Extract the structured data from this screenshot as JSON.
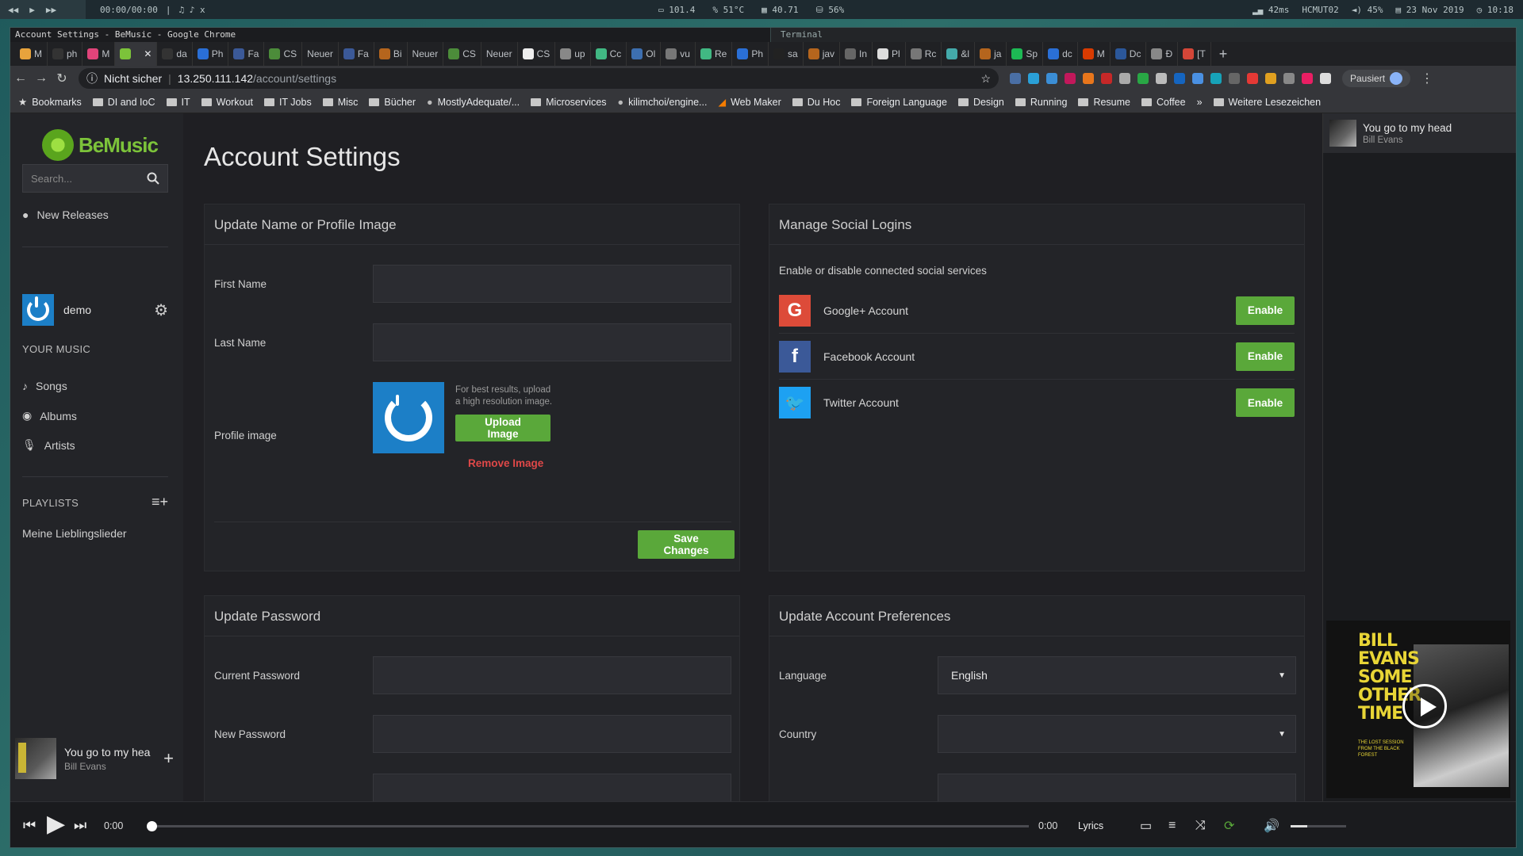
{
  "system_bar": {
    "media_time": "00:00/00:00",
    "sep": "|",
    "notes": "♫ ♪ x",
    "cpu": "101.4",
    "temp": "51°C",
    "mem": "40.71",
    "disk": "56%",
    "latency": "42ms",
    "network": "HCMUT02",
    "volume": "45%",
    "date": "23 Nov 2019",
    "time": "10:18"
  },
  "window": {
    "title": "Account Settings - BeMusic - Google Chrome",
    "terminal_title": "Terminal"
  },
  "tabs": [
    {
      "label": "M",
      "color": "#e8a33c"
    },
    {
      "label": "ph",
      "color": "#333"
    },
    {
      "label": "M",
      "color": "#e0447a"
    },
    {
      "label": "",
      "color": "#7cc33a",
      "active": true
    },
    {
      "label": "da",
      "color": "#333"
    },
    {
      "label": "Ph",
      "color": "#2a6fd6"
    },
    {
      "label": "Fa",
      "color": "#3b5998"
    },
    {
      "label": "CS",
      "color": "#4c8c3a"
    },
    {
      "label": "Neuer",
      "color": ""
    },
    {
      "label": "Fa",
      "color": "#3b5998"
    },
    {
      "label": "Bi",
      "color": "#b5651d"
    },
    {
      "label": "Neuer",
      "color": ""
    },
    {
      "label": "CS",
      "color": "#4c8c3a"
    },
    {
      "label": "Neuer",
      "color": ""
    },
    {
      "label": "CS",
      "color": "#eee"
    },
    {
      "label": "up",
      "color": "#888"
    },
    {
      "label": "Cc",
      "color": "#41b883"
    },
    {
      "label": "Ol",
      "color": "#3d6fb0"
    },
    {
      "label": "vu",
      "color": "#777"
    },
    {
      "label": "Re",
      "color": "#41b883"
    },
    {
      "label": "Ph",
      "color": "#2a6fd6"
    },
    {
      "label": "sa",
      "color": "#222"
    },
    {
      "label": "jav",
      "color": "#b5651d"
    },
    {
      "label": "In",
      "color": "#666"
    },
    {
      "label": "Pl",
      "color": "#ddd"
    },
    {
      "label": "Rc",
      "color": "#777"
    },
    {
      "label": "&l",
      "color": "#4aa"
    },
    {
      "label": "ja",
      "color": "#b5651d"
    },
    {
      "label": "Sp",
      "color": "#1db954"
    },
    {
      "label": "dc",
      "color": "#2a6fd6"
    },
    {
      "label": "M",
      "color": "#d83b01"
    },
    {
      "label": "Dc",
      "color": "#2b579a"
    },
    {
      "label": "Đ",
      "color": "#888"
    },
    {
      "label": "[T",
      "color": "#d44638"
    }
  ],
  "address": {
    "security": "Nicht sicher",
    "host": "13.250.111.142",
    "path": "/account/settings",
    "profile": "Pausiert"
  },
  "bookmarks": [
    {
      "label": "Bookmarks",
      "icon": "star-icon"
    },
    {
      "label": "DI and IoC",
      "icon": "folder-icon"
    },
    {
      "label": "IT",
      "icon": "folder-icon"
    },
    {
      "label": "Workout",
      "icon": "folder-icon"
    },
    {
      "label": "IT Jobs",
      "icon": "folder-icon"
    },
    {
      "label": "Misc",
      "icon": "folder-icon"
    },
    {
      "label": "Bücher",
      "icon": "folder-icon"
    },
    {
      "label": "MostlyAdequate/...",
      "icon": "github-icon"
    },
    {
      "label": "Microservices",
      "icon": "folder-icon"
    },
    {
      "label": "kilimchoi/engine...",
      "icon": "github-icon"
    },
    {
      "label": "Web Maker",
      "icon": "webmaker-icon"
    },
    {
      "label": "Du Hoc",
      "icon": "folder-icon"
    },
    {
      "label": "Foreign Language",
      "icon": "folder-icon"
    },
    {
      "label": "Design",
      "icon": "folder-icon"
    },
    {
      "label": "Running",
      "icon": "folder-icon"
    },
    {
      "label": "Resume",
      "icon": "folder-icon"
    },
    {
      "label": "Coffee",
      "icon": "folder-icon"
    },
    {
      "label": "»",
      "icon": ""
    },
    {
      "label": "Weitere Lesezeichen",
      "icon": "folder-icon"
    }
  ],
  "sidebar": {
    "logo": "BeMusic",
    "search_placeholder": "Search...",
    "new_releases": "New Releases",
    "username": "demo",
    "your_music": "YOUR MUSIC",
    "songs": "Songs",
    "albums": "Albums",
    "artists": "Artists",
    "playlists": "PLAYLISTS",
    "playlist_items": [
      "Meine Lieblingslieder"
    ],
    "now_playing_title": "You go to my hea",
    "now_playing_artist": "Bill Evans"
  },
  "main": {
    "title": "Account Settings",
    "profile_panel": {
      "heading": "Update Name or Profile Image",
      "first_name": "First Name",
      "last_name": "Last Name",
      "profile_image": "Profile image",
      "hint_line1": "For best results, upload",
      "hint_line2": "a high resolution image.",
      "upload": "Upload Image",
      "remove": "Remove Image",
      "save": "Save Changes"
    },
    "social_panel": {
      "heading": "Manage Social Logins",
      "description": "Enable or disable connected social services",
      "google": "Google+ Account",
      "facebook": "Facebook Account",
      "twitter": "Twitter Account",
      "enable": "Enable",
      "colors": {
        "google": "#dd4b39",
        "facebook": "#3b5998",
        "twitter": "#1da1f2"
      }
    },
    "password_panel": {
      "heading": "Update Password",
      "current": "Current Password",
      "new": "New Password"
    },
    "prefs_panel": {
      "heading": "Update Account Preferences",
      "language_label": "Language",
      "language_value": "English",
      "country_label": "Country",
      "country_value": ""
    }
  },
  "right_panel": {
    "queue_title": "You go to my head",
    "queue_artist": "Bill Evans",
    "album_text": "BILL EVANS SOME OTHER TIME",
    "album_sub": "THE LOST SESSION FROM THE BLACK FOREST"
  },
  "player": {
    "elapsed": "0:00",
    "duration": "0:00",
    "lyrics": "Lyrics",
    "progress": 0,
    "volume": 0.3
  },
  "colors": {
    "accent": "#5aa83a",
    "danger": "#e04848",
    "brand": "#7cc33a"
  }
}
